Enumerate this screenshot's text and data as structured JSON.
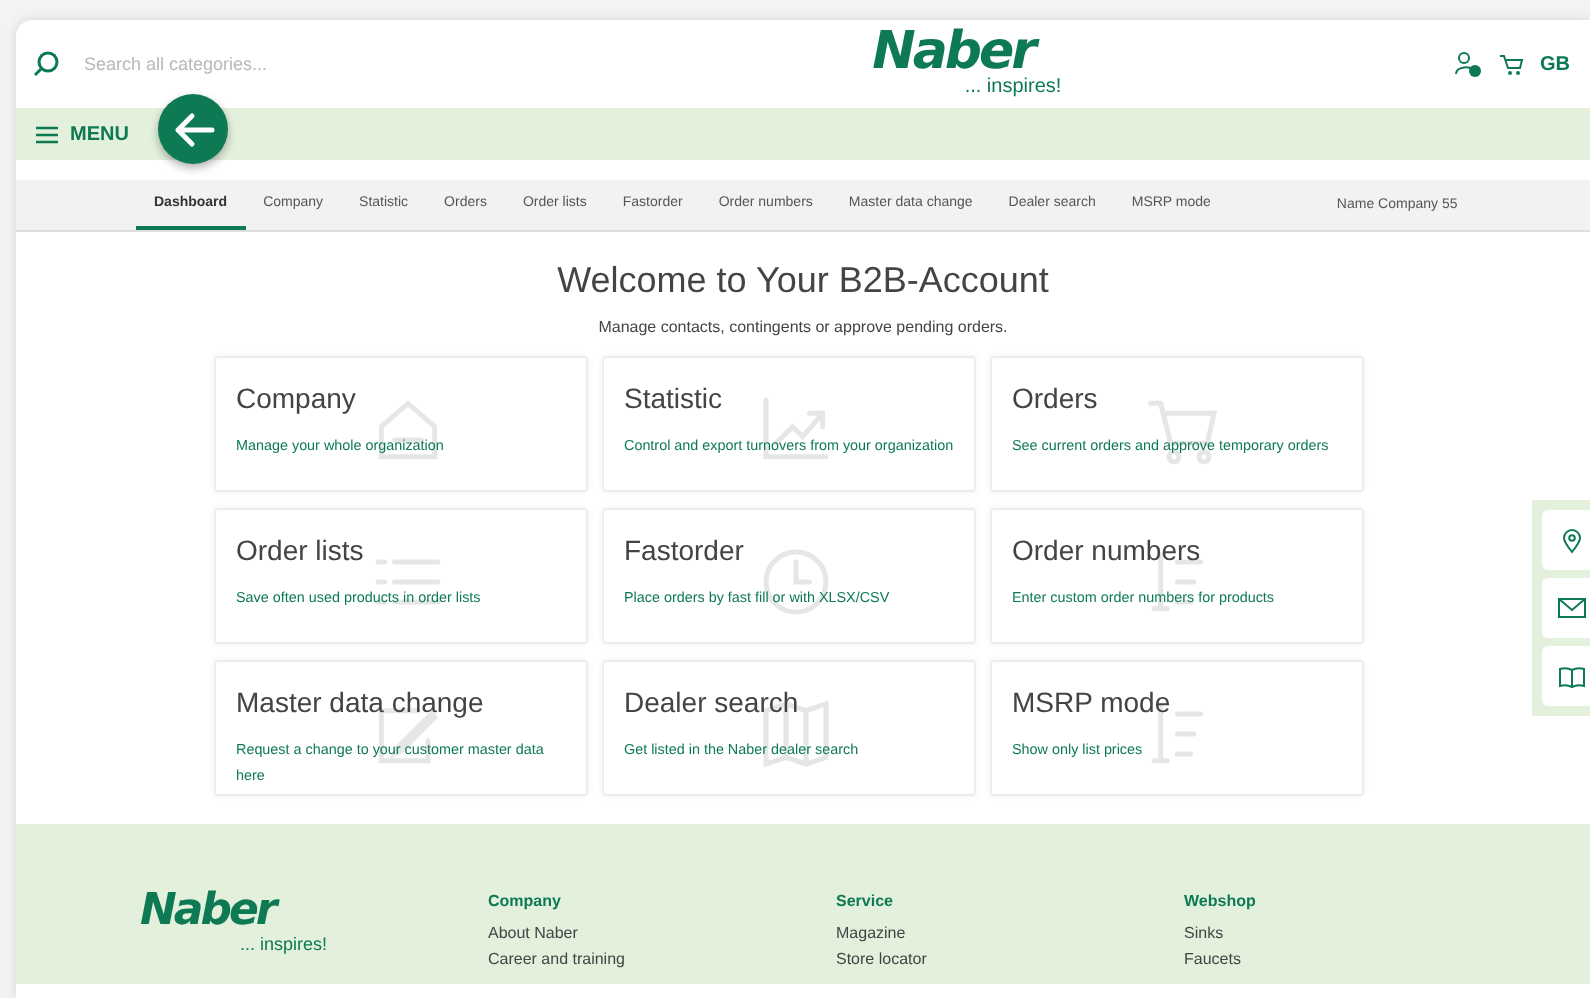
{
  "header": {
    "search": {
      "placeholder": "Search all categories..."
    },
    "logo": {
      "name": "Naber",
      "tagline": "... inspires!"
    },
    "language": "GB"
  },
  "menu_bar": {
    "label": "MENU"
  },
  "tabs": [
    {
      "label": "Dashboard",
      "selected": true
    },
    {
      "label": "Company",
      "selected": false
    },
    {
      "label": "Statistic",
      "selected": false
    },
    {
      "label": "Orders",
      "selected": false
    },
    {
      "label": "Order lists",
      "selected": false
    },
    {
      "label": "Fastorder",
      "selected": false
    },
    {
      "label": "Order numbers",
      "selected": false
    },
    {
      "label": "Master data change",
      "selected": false
    },
    {
      "label": "Dealer search",
      "selected": false
    },
    {
      "label": "MSRP mode",
      "selected": false
    }
  ],
  "account_name": "Name Company 55",
  "title": "Welcome to Your B2B-Account",
  "subtitle": "Manage contacts, contingents or approve pending orders.",
  "cards": [
    {
      "title": "Company",
      "text": "Manage your whole organization"
    },
    {
      "title": "Statistic",
      "text": "Control and export turnovers from your organization"
    },
    {
      "title": "Orders",
      "text": "See current orders and approve temporary orders"
    },
    {
      "title": "Order lists",
      "text": "Save often used products in order lists"
    },
    {
      "title": "Fastorder",
      "text": "Place orders by fast fill or with XLSX/CSV"
    },
    {
      "title": "Order numbers",
      "text": "Enter custom order numbers for products"
    },
    {
      "title": "Master data change",
      "text": "Request a change to your customer master data here"
    },
    {
      "title": "Dealer search",
      "text": "Get listed in the Naber dealer search"
    },
    {
      "title": "MSRP mode",
      "text": "Show only list prices"
    }
  ],
  "footer": {
    "logo": {
      "name": "Naber",
      "tagline": "... inspires!"
    },
    "columns": [
      {
        "heading": "Company",
        "links": [
          "About Naber",
          "Career and training"
        ]
      },
      {
        "heading": "Service",
        "links": [
          "Magazine",
          "Store locator"
        ]
      },
      {
        "heading": "Webshop",
        "links": [
          "Sinks",
          "Faucets"
        ]
      }
    ]
  }
}
